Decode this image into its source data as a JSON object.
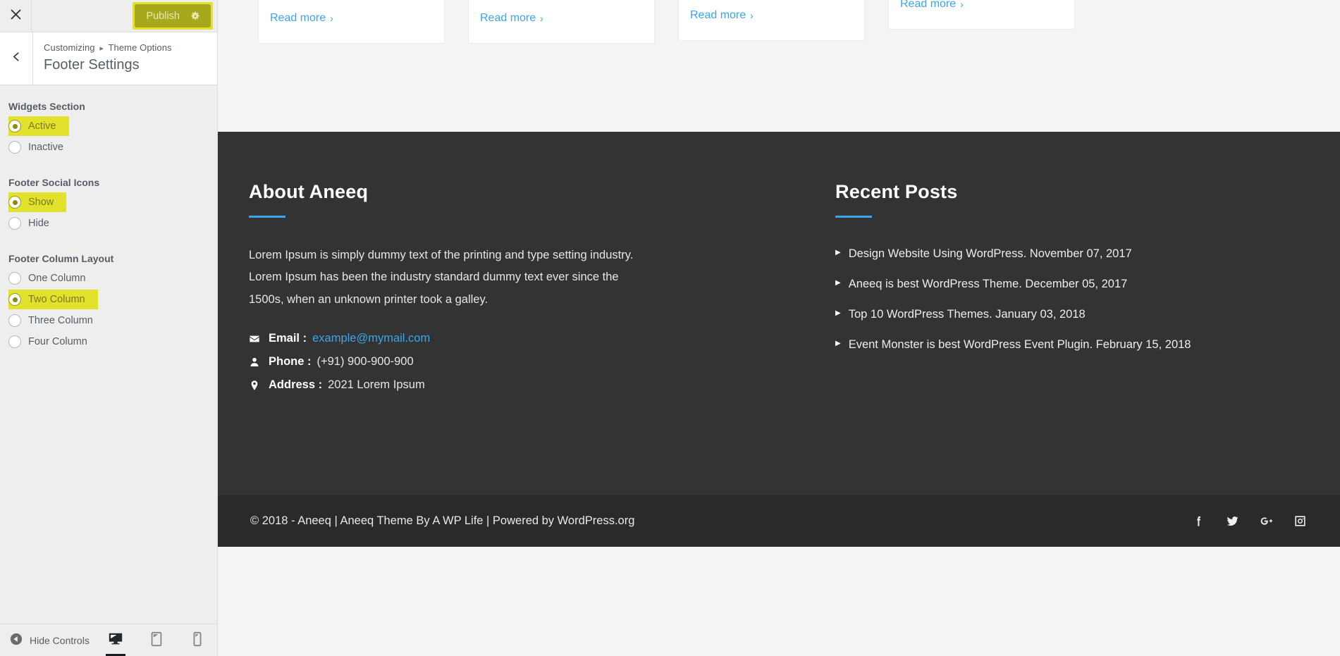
{
  "customizer": {
    "close_label": "Close",
    "publish_label": "Publish",
    "gear_icon": "gear-icon",
    "breadcrumb": {
      "root": "Customizing",
      "separator": "▸",
      "parent": "Theme Options"
    },
    "section_title": "Footer Settings",
    "groups": [
      {
        "label": "Widgets Section",
        "options": [
          {
            "label": "Active",
            "selected": true
          },
          {
            "label": "Inactive",
            "selected": false
          }
        ]
      },
      {
        "label": "Footer Social Icons",
        "options": [
          {
            "label": "Show",
            "selected": true
          },
          {
            "label": "Hide",
            "selected": false
          }
        ]
      },
      {
        "label": "Footer Column Layout",
        "options": [
          {
            "label": "One Column",
            "selected": false
          },
          {
            "label": "Two Column",
            "selected": true
          },
          {
            "label": "Three Column",
            "selected": false
          },
          {
            "label": "Four Column",
            "selected": false
          }
        ]
      }
    ],
    "footer_bar": {
      "hide_controls_label": "Hide Controls",
      "devices": [
        {
          "name": "desktop",
          "active": true
        },
        {
          "name": "tablet",
          "active": false
        },
        {
          "name": "mobile",
          "active": false
        }
      ]
    },
    "accent_yellow": "#e2e22c",
    "publish_bg": "#a7a81b"
  },
  "preview": {
    "cards": [
      {
        "label": "Read more",
        "chevron": "›"
      },
      {
        "label": "Read more",
        "chevron": "›"
      },
      {
        "label": "Read more",
        "chevron": "›"
      },
      {
        "label": "Read more",
        "chevron": "›"
      }
    ],
    "footer": {
      "about": {
        "title": "About Aneeq",
        "description": "Lorem Ipsum is simply dummy text of the printing and type setting industry. Lorem Ipsum has been the industry standard dummy text ever since the 1500s, when an unknown printer took a galley.",
        "contacts": [
          {
            "icon": "envelope-icon",
            "key": "Email :",
            "value": "example@mymail.com",
            "is_link": true
          },
          {
            "icon": "user-icon",
            "key": "Phone :",
            "value": "(+91) 900-900-900",
            "is_link": false
          },
          {
            "icon": "map-pin-icon",
            "key": "Address :",
            "value": "2021 Lorem Ipsum",
            "is_link": false
          }
        ]
      },
      "recent_posts": {
        "title": "Recent Posts",
        "items": [
          "Design Website Using WordPress. November 07, 2017",
          "Aneeq is best WordPress Theme. December 05, 2017",
          "Top 10 WordPress Themes. January 03, 2018",
          "Event Monster is best WordPress Event Plugin. February 15, 2018"
        ]
      },
      "copyright": "© 2018 - Aneeq | Aneeq Theme By A WP Life | Powered by WordPress.org",
      "socials": [
        {
          "name": "facebook-icon"
        },
        {
          "name": "twitter-icon"
        },
        {
          "name": "google-plus-icon"
        },
        {
          "name": "instagram-icon"
        }
      ],
      "accent_blue": "#3aa5ea",
      "bg_dark": "#333333",
      "bg_darker": "#2a2a2a"
    }
  }
}
